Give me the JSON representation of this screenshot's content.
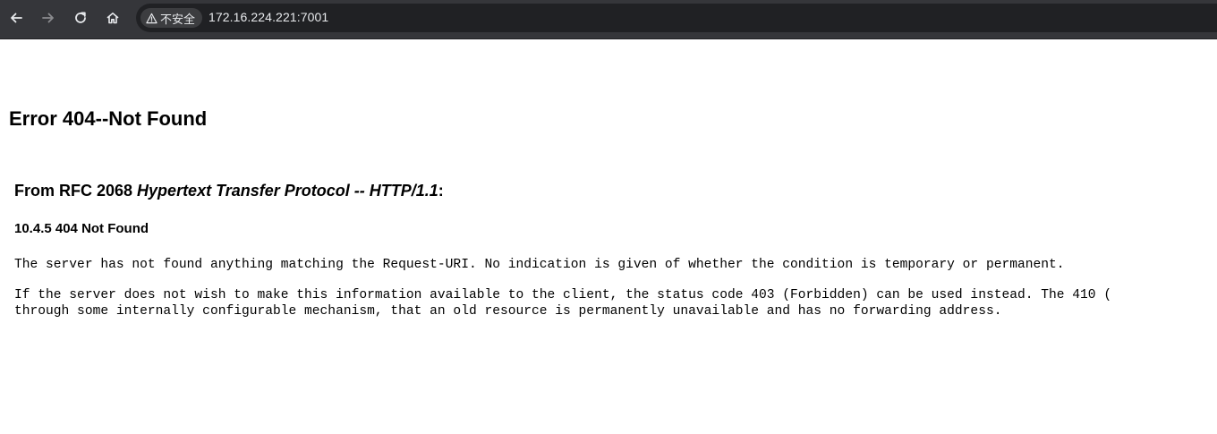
{
  "browser": {
    "security_label": "不安全",
    "url": "172.16.224.221:7001",
    "icons": {
      "back": "arrow-left-icon",
      "forward": "arrow-right-icon",
      "reload": "reload-icon",
      "home": "home-icon",
      "warning": "warning-triangle-icon"
    }
  },
  "page": {
    "title": "Error 404--Not Found",
    "rfc_prefix": "From RFC 2068 ",
    "rfc_title": "Hypertext Transfer Protocol -- HTTP/1.1",
    "rfc_suffix": ":",
    "section": "10.4.5 404 Not Found",
    "paragraph1": "The server has not found anything matching the Request-URI. No indication is given of whether the condition is temporary or permanent.",
    "paragraph2_line1": "If the server does not wish to make this information available to the client, the status code 403 (Forbidden) can be used instead. The 410 (",
    "paragraph2_line2": "through some internally configurable mechanism, that an old resource is permanently unavailable and has no forwarding address."
  }
}
